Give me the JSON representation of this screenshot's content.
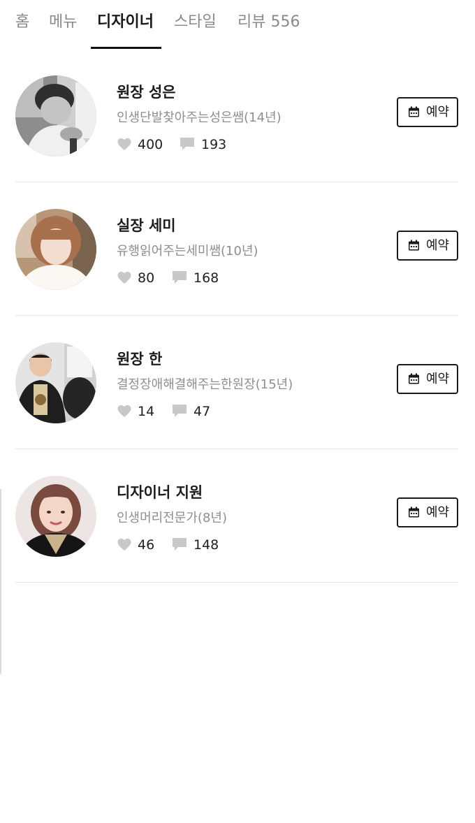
{
  "tabs": [
    {
      "label": "홈"
    },
    {
      "label": "메뉴"
    },
    {
      "label": "디자이너",
      "active": true
    },
    {
      "label": "스타일"
    },
    {
      "label": "리뷰 556"
    }
  ],
  "designers": [
    {
      "name": "원장 성은",
      "desc": "인생단발찾아주는성은쌤(14년)",
      "likes": "400",
      "comments": "193",
      "reserve_label": "예약"
    },
    {
      "name": "실장 세미",
      "desc": "유행읽어주는세미쌤(10년)",
      "likes": "80",
      "comments": "168",
      "reserve_label": "예약"
    },
    {
      "name": "원장 한",
      "desc": "결정장애해결해주는한원장(15년)",
      "likes": "14",
      "comments": "47",
      "reserve_label": "예약"
    },
    {
      "name": "디자이너 지원",
      "desc": "인생머리전문가(8년)",
      "likes": "46",
      "comments": "148",
      "reserve_label": "예약"
    }
  ],
  "icons": {
    "like": "heart-icon",
    "comment": "speech-bubble-icon",
    "reserve": "calendar-icon"
  },
  "colors": {
    "active_tab": "#111111",
    "inactive_tab": "#8a8a8a",
    "stat_icon": "#c8c8c8",
    "divider": "#e6e6e6"
  }
}
